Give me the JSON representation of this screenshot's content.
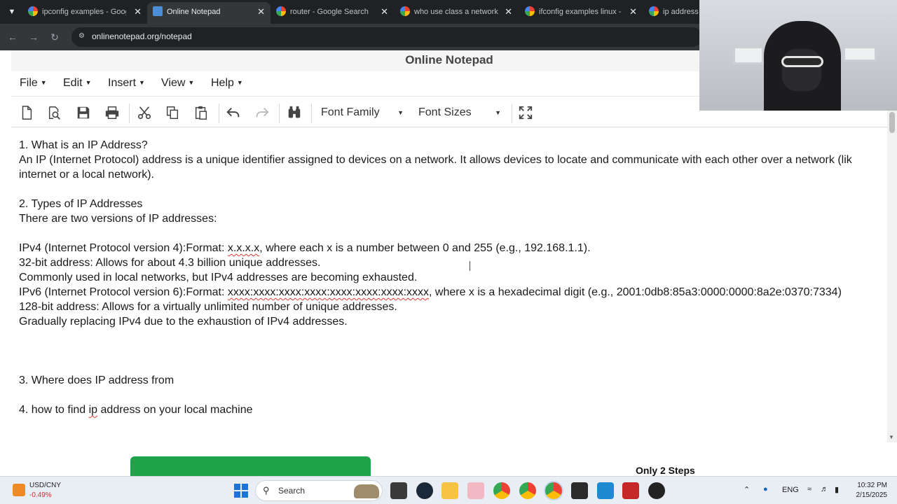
{
  "browser": {
    "tabs": [
      {
        "title": "ipconfig examples - Googl",
        "active": false,
        "icon": "google-icon"
      },
      {
        "title": "Online Notepad",
        "active": true,
        "icon": "notepad-icon"
      },
      {
        "title": "router - Google Search",
        "active": false,
        "icon": "google-icon"
      },
      {
        "title": "who use class a network -",
        "active": false,
        "icon": "google-icon"
      },
      {
        "title": "ifconfig examples linux - G",
        "active": false,
        "icon": "google-icon"
      },
      {
        "title": "ip address -",
        "active": false,
        "icon": "google-icon"
      }
    ],
    "url": "onlinenotepad.org/notepad"
  },
  "app": {
    "title": "Online Notepad",
    "menus": [
      "File",
      "Edit",
      "Insert",
      "View",
      "Help"
    ],
    "toolbar": {
      "font_family_label": "Font Family",
      "font_size_label": "Font Sizes",
      "icons": [
        "new-document-icon",
        "open-icon",
        "save-icon",
        "print-icon",
        "cut-icon",
        "copy-icon",
        "paste-icon",
        "undo-icon",
        "redo-icon",
        "find-icon",
        "fullscreen-icon"
      ]
    }
  },
  "document": {
    "l1": "1. What is an IP Address?",
    "l2": "An IP (Internet Protocol) address is a unique identifier assigned to devices on a network. It allows devices to locate and communicate with each other over a network (lik",
    "l3": "internet or a local network).",
    "l4": "2. Types of IP Addresses",
    "l5": "There are two versions of IP addresses:",
    "l6a": "IPv4 (Internet Protocol version 4):Format: ",
    "l6b": "x.x.x.x",
    "l6c": ", where each x is a number between 0 and 255 (e.g., 192.168.1.1).",
    "l7": "32-bit address: Allows for about 4.3 billion unique addresses.",
    "l8": "Commonly used in local networks, but IPv4 addresses are becoming exhausted.",
    "l9a": "IPv6 (Internet Protocol version 6):Format: ",
    "l9b": "xxxx:xxxx:xxxx:xxxx:xxxx:xxxx:xxxx:xxxx",
    "l9c": ", where x is a hexadecimal digit (e.g., 2001:0db8:85a3:0000:0000:8a2e:0370:7334)",
    "l10": "128-bit address: Allows for a virtually unlimited number of unique addresses.",
    "l11": "Gradually replacing IPv4 due to the exhaustion of IPv4 addresses.",
    "l12": "3. Where does IP address from",
    "l13a": "4. how to find ",
    "l13b": "ip",
    "l13c": " address on your local machine"
  },
  "ad": {
    "steps_text": "Only 2 Steps"
  },
  "taskbar": {
    "ticker_symbol": "USD/CNY",
    "ticker_change": "-0.49%",
    "search_label": "Search",
    "language": "ENG",
    "time": "10:32 PM",
    "date": "2/15/2025"
  }
}
